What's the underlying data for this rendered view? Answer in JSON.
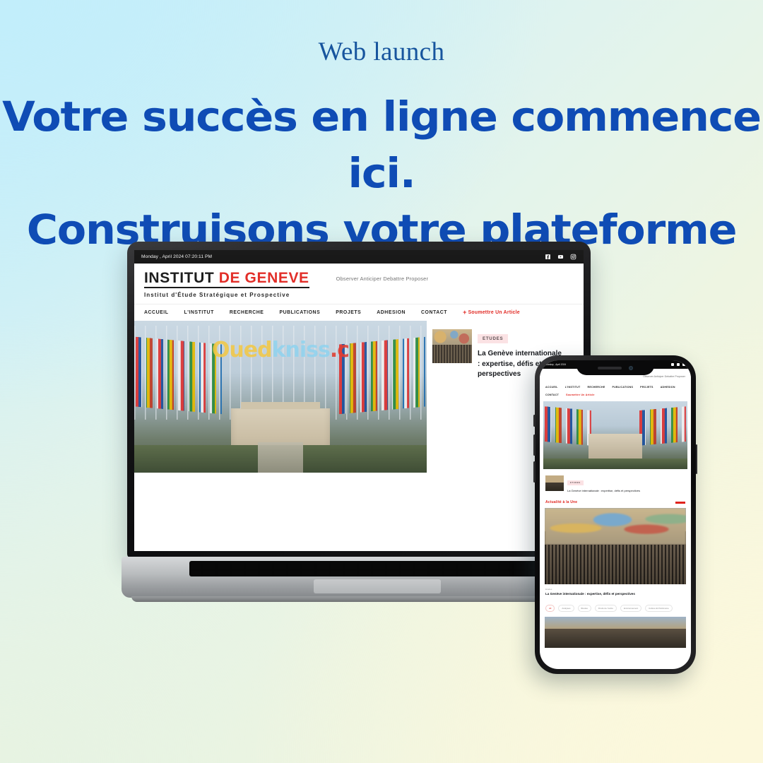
{
  "poster": {
    "eyebrow": "Web launch",
    "headline_line1": "Votre succès en ligne commence ici.",
    "headline_line2": "Construisons votre plateforme",
    "colors": {
      "headline": "#0f4cb5",
      "eyebrow": "#17559e",
      "bg_top_left": "#c6eefa",
      "bg_bottom_left": "#e8f3e3",
      "bg_bottom_right": "#fbf7dc",
      "brand_red": "#e0231d"
    }
  },
  "laptop": {
    "site": {
      "topbar": {
        "date": "Monday , April 2024 07:20:11 PM",
        "socials": [
          "facebook-icon",
          "youtube-icon",
          "instagram-icon"
        ]
      },
      "brand": {
        "name_part1": "INSTITUT ",
        "name_part2": "DE GENEVE",
        "subtitle": "Institut d'Étude Stratégique et Prospective",
        "tagline": "Observer Anticiper Debattre Proposer"
      },
      "nav": {
        "items": [
          "ACCUEIL",
          "L'INSTITUT",
          "RECHERCHE",
          "PUBLICATIONS",
          "PROJETS",
          "ADHESION",
          "CONTACT"
        ],
        "cta": "Soumettre Un Article",
        "cta_icon": "plus-icon"
      },
      "hero": {
        "watermark_part1": "Oued",
        "watermark_part2": "kniss",
        "watermark_part3": ".c",
        "alt": "Palais des Nations flags"
      },
      "sidebar_article": {
        "badge": "ETUDES",
        "title": "La Genève internationale : expertise, défis et perspectives",
        "title_visible": "La Genève inter\nexpertise, défis"
      }
    }
  },
  "phone": {
    "site": {
      "topbar": {
        "date": "Monday , April 2024"
      },
      "tagline": "Observer Anticiper Debattre Proposer",
      "nav": {
        "items": [
          "ACCUEIL",
          "L'INSTITUT",
          "RECHERCHE",
          "PUBLICATIONS",
          "PROJETS",
          "ADHESION",
          "CONTACT"
        ],
        "cta": "Soumettre Un Article"
      },
      "list_article": {
        "badge": "ETUDES",
        "title": "La Genève internationale : expertise, défis et perspectives"
      },
      "section": {
        "title": "Actualité à la Une"
      },
      "feature": {
        "kicker": "Etudes",
        "title": "La Genève internationale : expertise, défis et perspectives"
      },
      "chips": [
        "All",
        "Analyses",
        "Études",
        "Droits de l'ordre",
        "Environnement",
        "Culture Et Patrimoine"
      ]
    }
  }
}
